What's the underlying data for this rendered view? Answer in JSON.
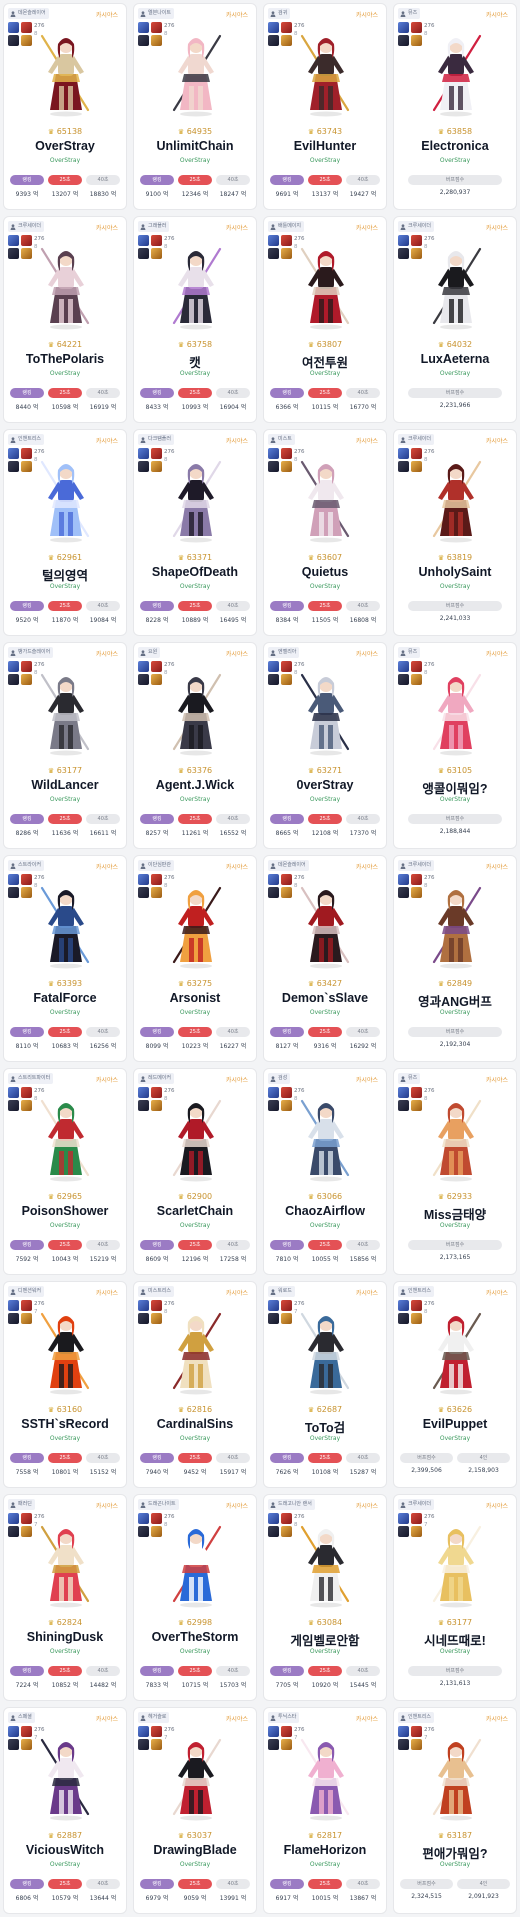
{
  "person_icon": "person-icon",
  "crown_icon": "crown-icon",
  "colors": {
    "accent_purple": "#9b7bc4",
    "accent_red": "#e45155",
    "server_orange": "#e39a36",
    "guild_green": "#3c9a5e",
    "fame_gold": "#c8932f"
  },
  "characters": [
    {
      "job": "데몬슬레이어",
      "server": "카시야스",
      "level": "276",
      "grade": "8",
      "fame": "65138",
      "name": "OverStray",
      "guild": "OverStray",
      "kind": "dealer",
      "pills": [
        "랭킹",
        "25초",
        "40초"
      ],
      "values": [
        "9393 억",
        "13207 억",
        "18830 억"
      ],
      "palette": [
        "#d9c7a0",
        "#7a1620",
        "#e0b34a"
      ]
    },
    {
      "job": "엘븐나이트",
      "server": "카시야스",
      "level": "276",
      "grade": "8",
      "fame": "64935",
      "name": "UnlimitChain",
      "guild": "OverStray",
      "kind": "dealer",
      "pills": [
        "랭킹",
        "25초",
        "40초"
      ],
      "values": [
        "9100 억",
        "12346 억",
        "18247 억"
      ],
      "palette": [
        "#f0d8d0",
        "#f2b7c4",
        "#3a3a44"
      ]
    },
    {
      "job": "검귀",
      "server": "카시야스",
      "level": "276",
      "grade": "8",
      "fame": "63743",
      "name": "EvilHunter",
      "guild": "OverStray",
      "kind": "dealer",
      "pills": [
        "랭킹",
        "25초",
        "40초"
      ],
      "values": [
        "9691 억",
        "13137 억",
        "19427 억"
      ],
      "palette": [
        "#3b2b2b",
        "#a0202a",
        "#d9a640"
      ]
    },
    {
      "job": "뮤즈",
      "server": "카시야스",
      "level": "276",
      "grade": "8",
      "fame": "63858",
      "name": "Electronica",
      "guild": "OverStray",
      "kind": "buffer",
      "pills": [
        "버프점수"
      ],
      "values": [
        "2,280,937"
      ],
      "palette": [
        "#3a2a3f",
        "#f0f0f5",
        "#d02040"
      ]
    },
    {
      "job": "크루세이더",
      "server": "카시야스",
      "level": "276",
      "grade": "8",
      "fame": "64221",
      "name": "ToThePolaris",
      "guild": "OverStray",
      "kind": "dealer",
      "pills": [
        "랭킹",
        "25초",
        "40초"
      ],
      "values": [
        "8440 억",
        "10598 억",
        "16919 억"
      ],
      "palette": [
        "#e8d0d8",
        "#5a4050",
        "#c0a0b0"
      ]
    },
    {
      "job": "그래플러",
      "server": "카시야스",
      "level": "276",
      "grade": "8",
      "fame": "63758",
      "name": "캣",
      "guild": "OverStray",
      "kind": "dealer",
      "pills": [
        "랭킹",
        "25초",
        "40초"
      ],
      "values": [
        "8433 억",
        "10993 억",
        "16904 억"
      ],
      "palette": [
        "#e8e0ea",
        "#2a2a38",
        "#b07ad0"
      ]
    },
    {
      "job": "배틀메이지",
      "server": "카시야스",
      "level": "276",
      "grade": "8",
      "fame": "63807",
      "name": "여전투원",
      "guild": "OverStray",
      "kind": "dealer",
      "pills": [
        "랭킹",
        "25초",
        "40초"
      ],
      "values": [
        "6366 억",
        "10115 억",
        "16770 억"
      ],
      "palette": [
        "#2a1a1c",
        "#b01a2a",
        "#e0d0c0"
      ]
    },
    {
      "job": "크루세이더",
      "server": "카시야스",
      "level": "276",
      "grade": "8",
      "fame": "64032",
      "name": "LuxAeterna",
      "guild": "OverStray",
      "kind": "buffer",
      "pills": [
        "버프점수"
      ],
      "values": [
        "2,231,966"
      ],
      "palette": [
        "#1a1a1e",
        "#e8e8ec",
        "#3a3a40"
      ]
    },
    {
      "job": "인챈트리스",
      "server": "카시야스",
      "level": "276",
      "grade": "8",
      "fame": "62961",
      "name": "털의영역",
      "guild": "OverStray",
      "kind": "dealer",
      "pills": [
        "랭킹",
        "25초",
        "40초"
      ],
      "values": [
        "9520 억",
        "11870 억",
        "19084 억"
      ],
      "palette": [
        "#4a6ad8",
        "#a0c0f8",
        "#e0e8ff"
      ]
    },
    {
      "job": "다크템플러",
      "server": "카시야스",
      "level": "276",
      "grade": "8",
      "fame": "63371",
      "name": "ShapeOfDeath",
      "guild": "OverStray",
      "kind": "dealer",
      "pills": [
        "랭킹",
        "25초",
        "40초"
      ],
      "values": [
        "8228 억",
        "10889 억",
        "16495 억"
      ],
      "palette": [
        "#1e1a28",
        "#8a7aa8",
        "#e0d8e8"
      ]
    },
    {
      "job": "미스트",
      "server": "카시야스",
      "level": "276",
      "grade": "8",
      "fame": "63607",
      "name": "Quietus",
      "guild": "OverStray",
      "kind": "dealer",
      "pills": [
        "랭킹",
        "25초",
        "40초"
      ],
      "values": [
        "8384 억",
        "11505 억",
        "16808 억"
      ],
      "palette": [
        "#f0e8ee",
        "#d0a0b8",
        "#6a5a70"
      ]
    },
    {
      "job": "크루세이더",
      "server": "카시야스",
      "level": "276",
      "grade": "8",
      "fame": "63819",
      "name": "UnholySaint",
      "guild": "OverStray",
      "kind": "buffer",
      "pills": [
        "버프점수"
      ],
      "values": [
        "2,241,033"
      ],
      "palette": [
        "#b0302a",
        "#5a1a18",
        "#e8c8a0"
      ]
    },
    {
      "job": "뱅가드슬레이어",
      "server": "카시야스",
      "level": "276",
      "grade": "8",
      "fame": "63177",
      "name": "WildLancer",
      "guild": "OverStray",
      "kind": "dealer",
      "pills": [
        "랭킹",
        "25초",
        "40초"
      ],
      "values": [
        "8286 억",
        "11636 억",
        "16611 억"
      ],
      "palette": [
        "#2a2a30",
        "#7a7a88",
        "#c0c0c8"
      ]
    },
    {
      "job": "요원",
      "server": "카시야스",
      "level": "276",
      "grade": "8",
      "fame": "63376",
      "name": "Agent.J.Wick",
      "guild": "OverStray",
      "kind": "dealer",
      "pills": [
        "랭킹",
        "25초",
        "40초"
      ],
      "values": [
        "8257 억",
        "11261 억",
        "16552 억"
      ],
      "palette": [
        "#1a1a20",
        "#3a3a48",
        "#d0c0b0"
      ]
    },
    {
      "job": "엔젤리아",
      "server": "카시야스",
      "level": "276",
      "grade": "8",
      "fame": "63271",
      "name": "0verStray",
      "guild": "OverStray",
      "kind": "dealer",
      "pills": [
        "랭킹",
        "25초",
        "40초"
      ],
      "values": [
        "8665 억",
        "12108 억",
        "17370 억"
      ],
      "palette": [
        "#4a5a78",
        "#c8ccd8",
        "#2a3048"
      ]
    },
    {
      "job": "뮤즈",
      "server": "카시야스",
      "level": "276",
      "grade": "8",
      "fame": "63105",
      "name": "앵콜이뭐임?",
      "guild": "OverStray",
      "kind": "buffer",
      "pills": [
        "버프점수"
      ],
      "values": [
        "2,188,844"
      ],
      "palette": [
        "#f0a8c0",
        "#e04060",
        "#f8e0e8"
      ]
    },
    {
      "job": "스트라이커",
      "server": "카시야스",
      "level": "276",
      "grade": "8",
      "fame": "63393",
      "name": "FatalForce",
      "guild": "OverStray",
      "kind": "dealer",
      "pills": [
        "랭킹",
        "25초",
        "40초"
      ],
      "values": [
        "8110 억",
        "10683 억",
        "16256 억"
      ],
      "palette": [
        "#2a4a8a",
        "#1a1a28",
        "#6a9ad8"
      ]
    },
    {
      "job": "이단심판관",
      "server": "카시야스",
      "level": "276",
      "grade": "8",
      "fame": "63275",
      "name": "Arsonist",
      "guild": "OverStray",
      "kind": "dealer",
      "pills": [
        "랭킹",
        "25초",
        "40초"
      ],
      "values": [
        "8099 억",
        "10223 억",
        "16227 억"
      ],
      "palette": [
        "#c02020",
        "#f0a040",
        "#3a1a1a"
      ]
    },
    {
      "job": "데몬슬레이어",
      "server": "카시야스",
      "level": "276",
      "grade": "8",
      "fame": "63427",
      "name": "Demon`sSlave",
      "guild": "OverStray",
      "kind": "dealer",
      "pills": [
        "랭킹",
        "25초",
        "40초"
      ],
      "values": [
        "8127 억",
        "9316 억",
        "16292 억"
      ],
      "palette": [
        "#a01a20",
        "#2a1a1e",
        "#d8c0c0"
      ]
    },
    {
      "job": "크루세이더",
      "server": "카시야스",
      "level": "276",
      "grade": "8",
      "fame": "62849",
      "name": "영과ANG버프",
      "guild": "OverStray",
      "kind": "buffer",
      "pills": [
        "버프점수"
      ],
      "values": [
        "2,192,304"
      ],
      "palette": [
        "#6a3a28",
        "#b07040",
        "#7a4a8a"
      ]
    },
    {
      "job": "스트리트파이터",
      "server": "카시야스",
      "level": "276",
      "grade": "8",
      "fame": "62965",
      "name": "PoisonShower",
      "guild": "OverStray",
      "kind": "dealer",
      "pills": [
        "랭킹",
        "25초",
        "40초"
      ],
      "values": [
        "7592 억",
        "10043 억",
        "15219 억"
      ],
      "palette": [
        "#c02a30",
        "#2a8a4a",
        "#f0e0d0"
      ]
    },
    {
      "job": "레드메이커",
      "server": "카시야스",
      "level": "276",
      "grade": "8",
      "fame": "62900",
      "name": "ScarletChain",
      "guild": "OverStray",
      "kind": "dealer",
      "pills": [
        "랭킹",
        "25초",
        "40초"
      ],
      "values": [
        "8609 억",
        "12196 억",
        "17258 억"
      ],
      "palette": [
        "#b01a28",
        "#1a1a20",
        "#e8d8d0"
      ]
    },
    {
      "job": "검성",
      "server": "카시야스",
      "level": "276",
      "grade": "8",
      "fame": "63066",
      "name": "ChaozAirflow",
      "guild": "OverStray",
      "kind": "dealer",
      "pills": [
        "랭킹",
        "25초",
        "40초"
      ],
      "values": [
        "7810 억",
        "10055 억",
        "15856 억"
      ],
      "palette": [
        "#d8e0ea",
        "#3a4a6a",
        "#7aa0d0"
      ]
    },
    {
      "job": "뮤즈",
      "server": "카시야스",
      "level": "276",
      "grade": "8",
      "fame": "62933",
      "name": "Miss금태양",
      "guild": "OverStray",
      "kind": "buffer",
      "pills": [
        "버프점수"
      ],
      "values": [
        "2,173,165"
      ],
      "palette": [
        "#e8a060",
        "#c04a30",
        "#f0e0c8"
      ]
    },
    {
      "job": "디멘션워커",
      "server": "카시야스",
      "level": "276",
      "grade": "7",
      "fame": "63160",
      "name": "SSTH`sRecord",
      "guild": "OverStray",
      "kind": "dealer",
      "pills": [
        "랭킹",
        "25초",
        "40초"
      ],
      "values": [
        "7558 억",
        "10801 억",
        "15152 억"
      ],
      "palette": [
        "#1a1a1e",
        "#e04010",
        "#f0a040"
      ]
    },
    {
      "job": "미스트리스",
      "server": "카시야스",
      "level": "276",
      "grade": "8",
      "fame": "62816",
      "name": "CardinalSins",
      "guild": "OverStray",
      "kind": "dealer",
      "pills": [
        "랭킹",
        "25초",
        "40초"
      ],
      "values": [
        "7940 억",
        "9452 억",
        "15917 억"
      ],
      "palette": [
        "#d0a040",
        "#f0e0c0",
        "#8a2a2a"
      ]
    },
    {
      "job": "워로드",
      "server": "카시야스",
      "level": "276",
      "grade": "7",
      "fame": "62687",
      "name": "ToTo검",
      "guild": "OverStray",
      "kind": "dealer",
      "pills": [
        "랭킹",
        "25초",
        "40초"
      ],
      "values": [
        "7626 억",
        "10108 억",
        "15287 억"
      ],
      "palette": [
        "#2a2a30",
        "#3a6a9a",
        "#d0d8e0"
      ]
    },
    {
      "job": "인챈트리스",
      "server": "카시야스",
      "level": "276",
      "grade": "8",
      "fame": "63626",
      "name": "EvilPuppet",
      "guild": "OverStray",
      "kind": "buffer",
      "pills": [
        "버프점수",
        "4인"
      ],
      "values": [
        "2,399,506",
        "2,158,903"
      ],
      "palette": [
        "#f0f0f0",
        "#c02030",
        "#6a5a50"
      ]
    },
    {
      "job": "패러딘",
      "server": "카시야스",
      "level": "276",
      "grade": "7",
      "fame": "62824",
      "name": "ShiningDusk",
      "guild": "OverStray",
      "kind": "dealer",
      "pills": [
        "랭킹",
        "25초",
        "40초"
      ],
      "values": [
        "7224 억",
        "10852 억",
        "14482 억"
      ],
      "palette": [
        "#f0e0c8",
        "#e04050",
        "#d0a040"
      ]
    },
    {
      "job": "드래곤나이트",
      "server": "카시야스",
      "level": "276",
      "grade": "8",
      "fame": "62998",
      "name": "OverTheStorm",
      "guild": "OverStray",
      "kind": "dealer",
      "pills": [
        "랭킹",
        "25초",
        "40초"
      ],
      "values": [
        "7833 억",
        "10715 억",
        "15703 억"
      ],
      "palette": [
        "#ffffff",
        "#2a6ad8",
        "#d04040"
      ]
    },
    {
      "job": "드래고니안 랜서",
      "server": "카시야스",
      "level": "276",
      "grade": "8",
      "fame": "63084",
      "name": "게임벨로안함",
      "guild": "OverStray",
      "kind": "dealer",
      "pills": [
        "랭킹",
        "25초",
        "40초"
      ],
      "values": [
        "7705 억",
        "10920 억",
        "15445 억"
      ],
      "palette": [
        "#2a2a30",
        "#f0f0f0",
        "#e0a030"
      ]
    },
    {
      "job": "크루세이더",
      "server": "카시야스",
      "level": "276",
      "grade": "7",
      "fame": "63177",
      "name": "시네뜨때로!",
      "guild": "OverStray",
      "kind": "buffer",
      "pills": [
        "버프점수"
      ],
      "values": [
        "2,131,613"
      ],
      "palette": [
        "#f0d890",
        "#e8c060",
        "#f8f0e0"
      ]
    },
    {
      "job": "스페셜",
      "server": "카시야스",
      "level": "276",
      "grade": "7",
      "fame": "62887",
      "name": "ViciousWitch",
      "guild": "OverStray",
      "kind": "dealer",
      "pills": [
        "랭킹",
        "25초",
        "40초"
      ],
      "values": [
        "6806 억",
        "10579 억",
        "13644 억"
      ],
      "palette": [
        "#f0e8f0",
        "#6a3a8a",
        "#2a2a40"
      ]
    },
    {
      "job": "헤거슬로",
      "server": "카시야스",
      "level": "276",
      "grade": "7",
      "fame": "63037",
      "name": "DrawingBlade",
      "guild": "OverStray",
      "kind": "dealer",
      "pills": [
        "랭킹",
        "25초",
        "40초"
      ],
      "values": [
        "6979 억",
        "9059 억",
        "13991 억"
      ],
      "palette": [
        "#1a1a20",
        "#c02030",
        "#e8d8d0"
      ]
    },
    {
      "job": "투닉스타",
      "server": "카시야스",
      "level": "276",
      "grade": "7",
      "fame": "62817",
      "name": "FlameHorizon",
      "guild": "OverStray",
      "kind": "dealer",
      "pills": [
        "랭킹",
        "25초",
        "40초"
      ],
      "values": [
        "6917 억",
        "10015 억",
        "13867 억"
      ],
      "palette": [
        "#f0b0d0",
        "#8a5ab0",
        "#f8e8f0"
      ]
    },
    {
      "job": "인챈트리스",
      "server": "카시야스",
      "level": "276",
      "grade": "7",
      "fame": "63187",
      "name": "편애가뭐임?",
      "guild": "OverStray",
      "kind": "buffer",
      "pills": [
        "버프점수",
        "4인"
      ],
      "values": [
        "2,324,515",
        "2,091,923"
      ],
      "palette": [
        "#e8c090",
        "#c04020",
        "#f0e0d0"
      ]
    }
  ]
}
